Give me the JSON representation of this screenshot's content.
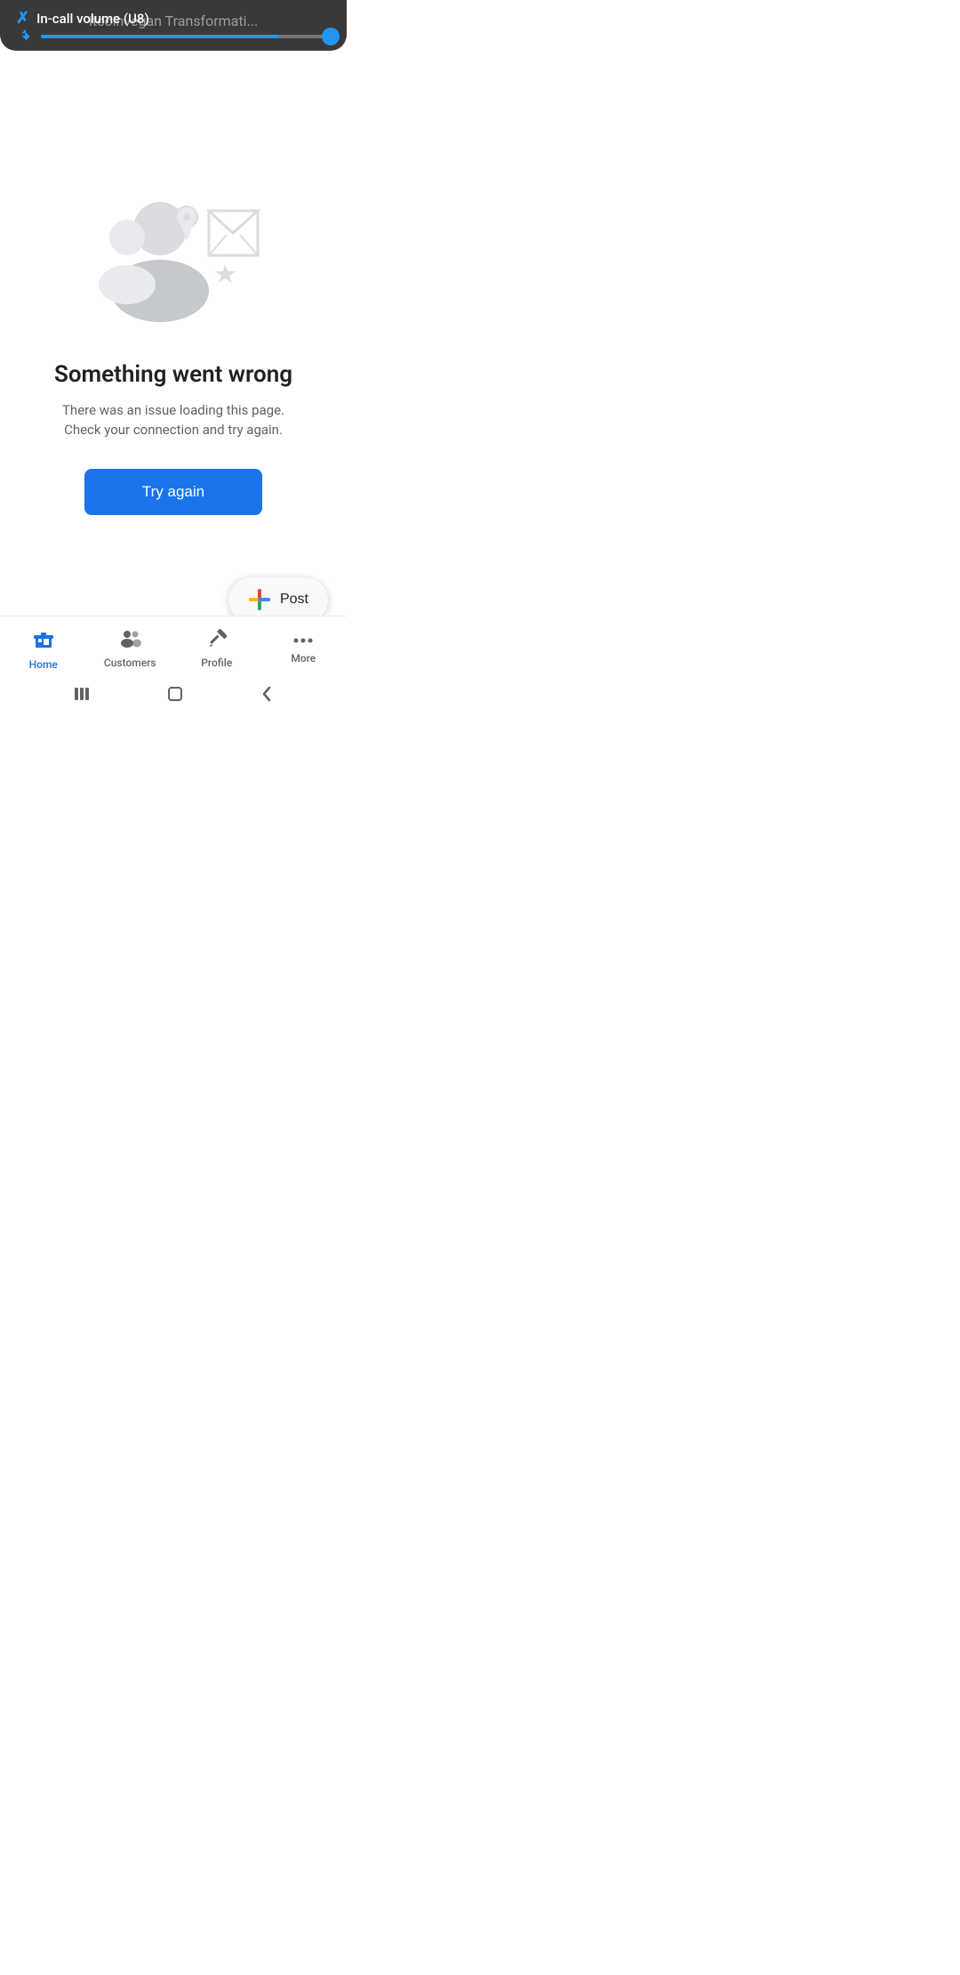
{
  "statusBar": {
    "volumeTitle": "In-call volume (U8)",
    "appTitle": "itcoinvegan Transformati..."
  },
  "errorPage": {
    "title": "Something went wrong",
    "subtitle": "There was an issue loading this page. Check your connection and try again.",
    "tryAgainLabel": "Try again"
  },
  "fab": {
    "label": "Post"
  },
  "bottomNav": {
    "items": [
      {
        "id": "home",
        "label": "Home",
        "active": true
      },
      {
        "id": "customers",
        "label": "Customers",
        "active": false
      },
      {
        "id": "profile",
        "label": "Profile",
        "active": false
      },
      {
        "id": "more",
        "label": "More",
        "active": false
      }
    ]
  },
  "colors": {
    "accent": "#1a73e8",
    "bluetooth": "#2196F3",
    "textPrimary": "#202124",
    "textSecondary": "#5f6368",
    "iconIllustration": "#dadce0"
  }
}
